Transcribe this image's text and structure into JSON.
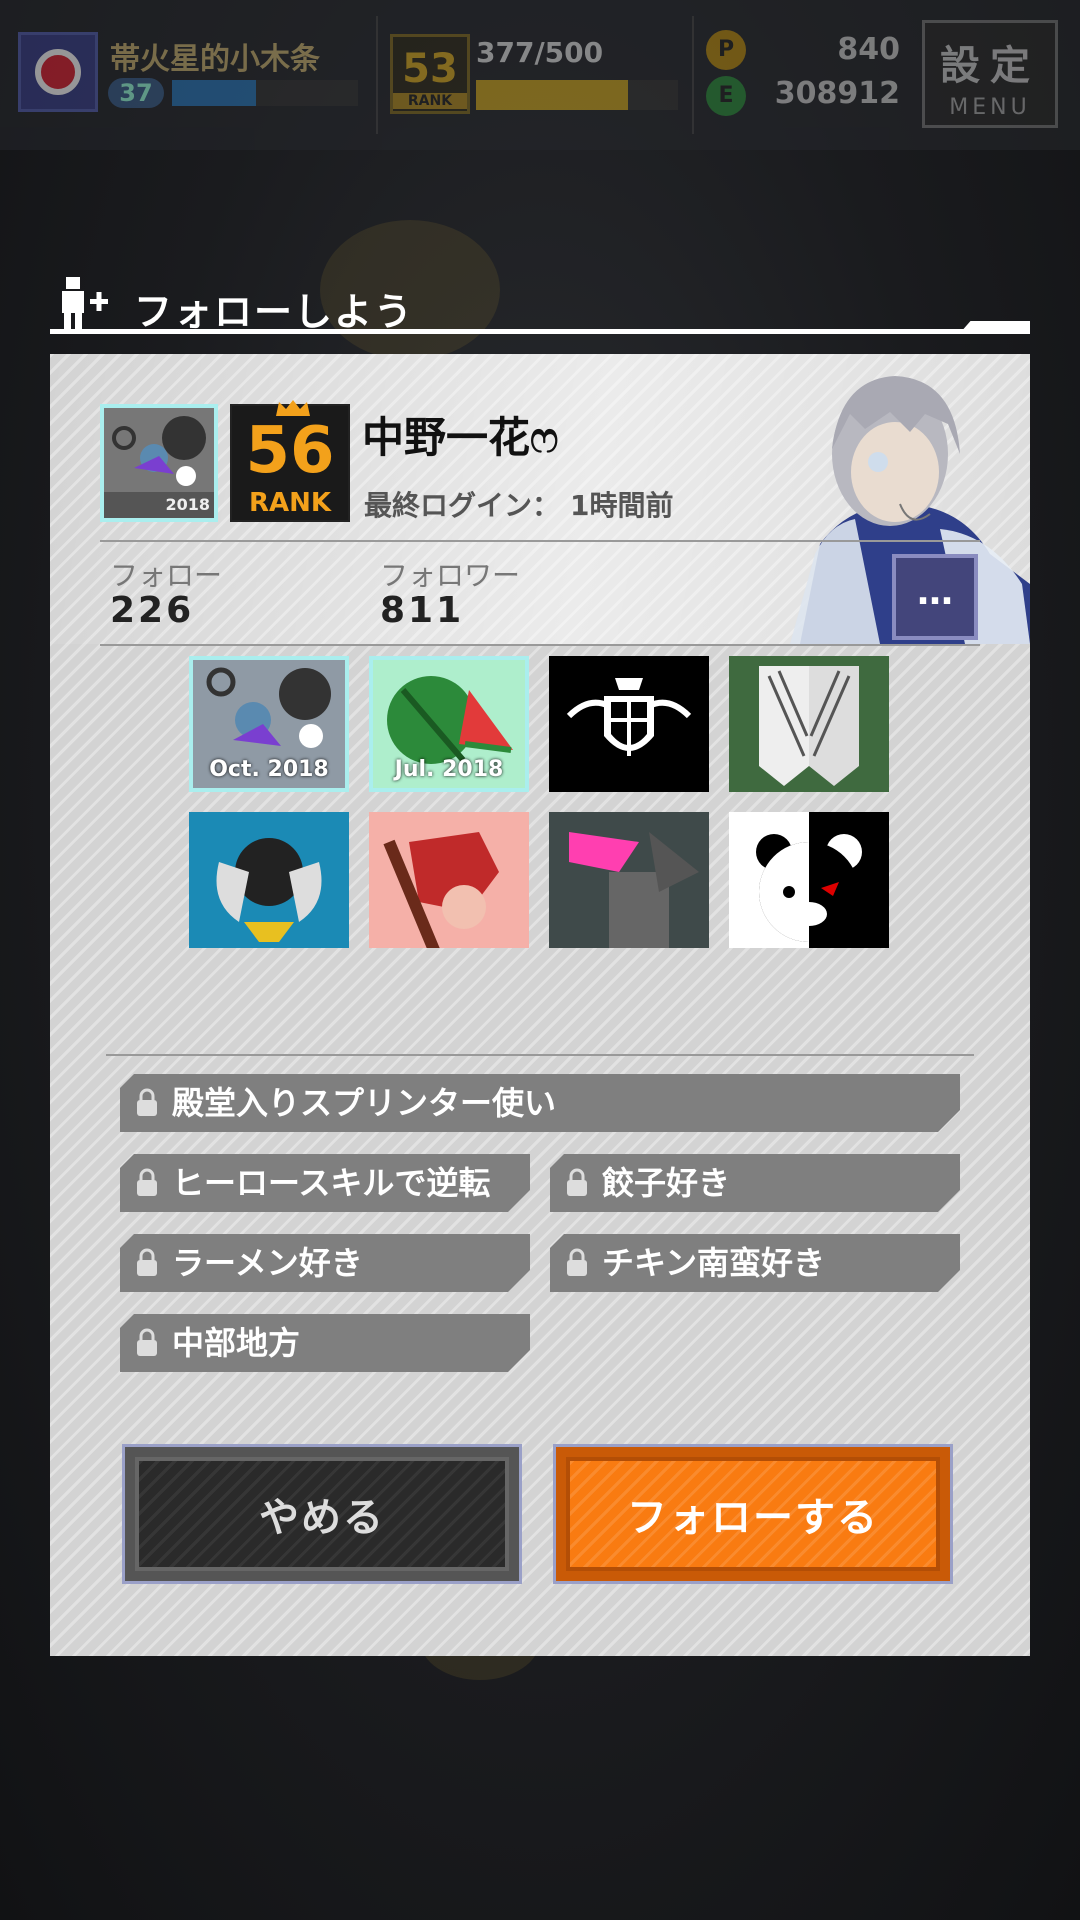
{
  "hud": {
    "player_name": "帯火星的小木条",
    "level": "37",
    "rank": "53",
    "rank_label": "RANK",
    "exp": "377/500",
    "coin_a": "840",
    "coin_b": "308912",
    "coin_a_icon": "P",
    "coin_b_icon": "E",
    "menu_kanji": "設定",
    "menu_en": "MENU"
  },
  "dialog": {
    "title": "フォローしよう"
  },
  "profile": {
    "avatar_tag": "2018",
    "rank_number": "56",
    "rank_label": "RANK",
    "name": "中野一花ෆ",
    "last_login_label": "最終ログイン：",
    "last_login_value": "1時間前",
    "follow_label": "フォロー",
    "follow_count": "226",
    "follower_label": "フォロワー",
    "follower_count": "811",
    "more_label": "…"
  },
  "badges": [
    {
      "caption": "Oct. 2018"
    },
    {
      "caption": "Jul. 2018"
    },
    {
      "caption": ""
    },
    {
      "caption": ""
    },
    {
      "caption": ""
    },
    {
      "caption": ""
    },
    {
      "caption": ""
    },
    {
      "caption": ""
    }
  ],
  "tags": [
    "殿堂入りスプリンター使い",
    "ヒーロースキルで逆転",
    "餃子好き",
    "ラーメン好き",
    "チキン南蛮好き",
    "中部地方"
  ],
  "buttons": {
    "cancel": "やめる",
    "follow": "フォローする"
  },
  "colors": {
    "accent_orange": "#f97b11",
    "rank_gold": "#f3a11b",
    "tag_gray": "#7f7f7f",
    "more_button": "#43457b"
  }
}
